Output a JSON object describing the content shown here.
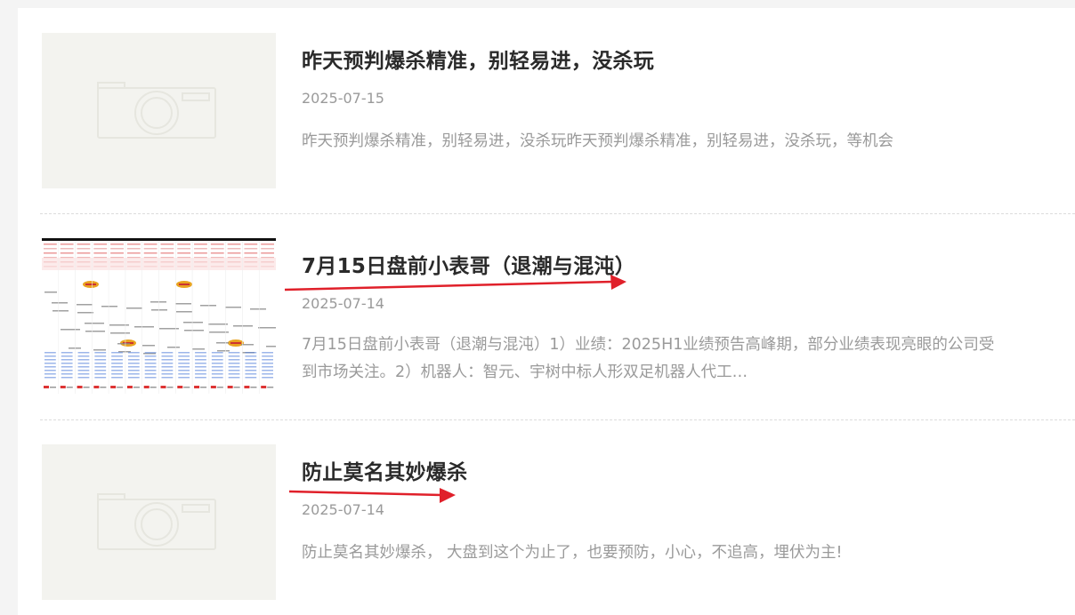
{
  "articles": [
    {
      "title": "昨天预判爆杀精准，别轻易进，没杀玩",
      "date": "2025-07-15",
      "excerpt": "昨天预判爆杀精准，别轻易进，没杀玩昨天预判爆杀精准，别轻易进，没杀玩，等机会",
      "thumbnail": "camera-placeholder-icon"
    },
    {
      "title": "7月15日盘前小表哥（退潮与混沌）",
      "date": "2025-07-14",
      "excerpt_line1": "7月15日盘前小表哥（退潮与混沌）1）业绩：2025H1业绩预告高峰期，部分业绩表现亮眼的公司受",
      "excerpt_line2": "到市场关注。2）机器人：智元、宇树中标人形双足机器人代工…",
      "thumbnail": "spreadsheet-thumbnail"
    },
    {
      "title": "防止莫名其妙爆杀",
      "date": "2025-07-14",
      "excerpt": "防止莫名其妙爆杀，  大盘到这个为止了，也要预防，小心，不追高，埋伏为主!",
      "thumbnail": "camera-placeholder-icon"
    }
  ],
  "colors": {
    "arrow": "#e0202a",
    "title": "#2a2a2a",
    "meta": "#9a9a9a",
    "placeholder_bg": "#f3f3ef"
  }
}
